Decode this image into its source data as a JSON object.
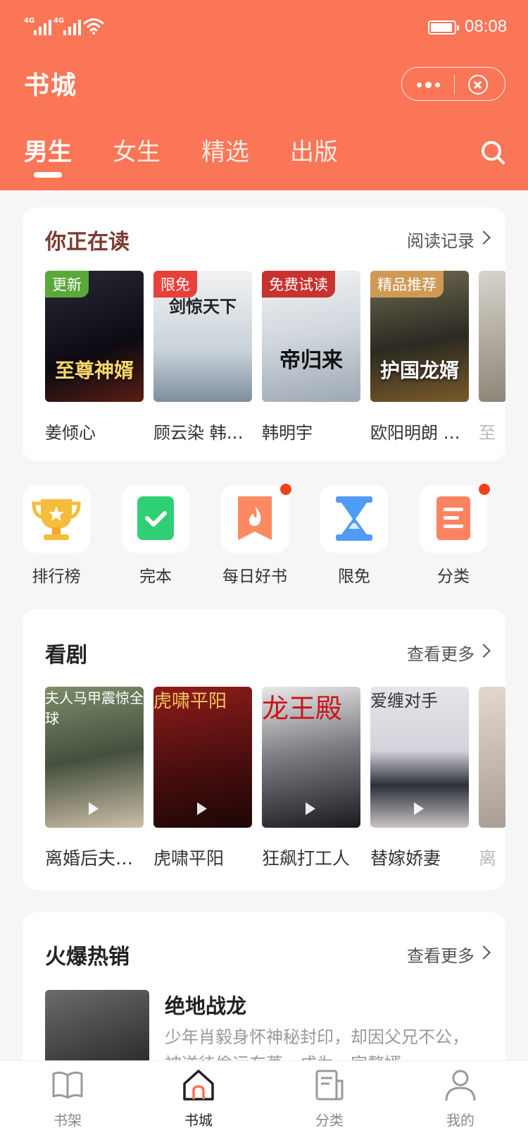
{
  "status_bar": {
    "signal_1": "4G",
    "signal_2": "4G",
    "battery_level": 0.95,
    "time": "08:08"
  },
  "header": {
    "title": "书城",
    "tabs": [
      {
        "label": "男生",
        "active": true
      },
      {
        "label": "女生",
        "active": false
      },
      {
        "label": "精选",
        "active": false
      },
      {
        "label": "出版",
        "active": false
      }
    ]
  },
  "reading": {
    "title": "你正在读",
    "more": "阅读记录",
    "books": [
      {
        "name": "姜倾心",
        "badge": "更新",
        "badge_color": "#5aa83a",
        "cover_text": "至尊神婿"
      },
      {
        "name": "顾云染 韩…",
        "badge": "限免",
        "badge_color": "#e8403a",
        "cover_text": "剑惊天下"
      },
      {
        "name": "韩明宇",
        "badge": "免费试读",
        "badge_color": "#c8322f",
        "cover_text": "帝归来"
      },
      {
        "name": "欧阳明朗 …",
        "badge": "精品推荐",
        "badge_color": "#cf9a55",
        "cover_text": "护国龙婿"
      },
      {
        "name": "至",
        "badge": "",
        "badge_color": "",
        "cover_text": ""
      }
    ]
  },
  "quick_entries": [
    {
      "label": "排行榜",
      "icon": "trophy-icon",
      "dot": false
    },
    {
      "label": "完本",
      "icon": "check-book-icon",
      "dot": false
    },
    {
      "label": "每日好书",
      "icon": "fire-bookmark-icon",
      "dot": true
    },
    {
      "label": "限免",
      "icon": "hourglass-icon",
      "dot": false
    },
    {
      "label": "分类",
      "icon": "list-icon",
      "dot": true
    }
  ],
  "drama": {
    "title": "看剧",
    "more": "查看更多",
    "items": [
      {
        "name": "离婚后夫…",
        "cover_text": "夫人马甲震惊全球"
      },
      {
        "name": "虎啸平阳",
        "cover_text": "虎啸平阳"
      },
      {
        "name": "狂飙打工人",
        "cover_text": "龙王殿"
      },
      {
        "name": "替嫁娇妻",
        "cover_text": "爱缠对手"
      },
      {
        "name": "离",
        "cover_text": ""
      }
    ]
  },
  "hot": {
    "title": "火爆热销",
    "more": "查看更多",
    "book_title": "绝地战龙",
    "book_desc": "少年肖毅身怀神秘封印，却因父兄不公，被逆徒偷运东菱，成为一家赘婿…"
  },
  "bottom_nav": [
    {
      "label": "书架",
      "icon": "bookshelf-icon",
      "active": false
    },
    {
      "label": "书城",
      "icon": "home-icon",
      "active": true
    },
    {
      "label": "分类",
      "icon": "category-icon",
      "active": false
    },
    {
      "label": "我的",
      "icon": "profile-icon",
      "active": false
    }
  ],
  "colors": {
    "accent": "#fa7656",
    "background": "#f6f6f7",
    "dot": "#f5401c"
  }
}
